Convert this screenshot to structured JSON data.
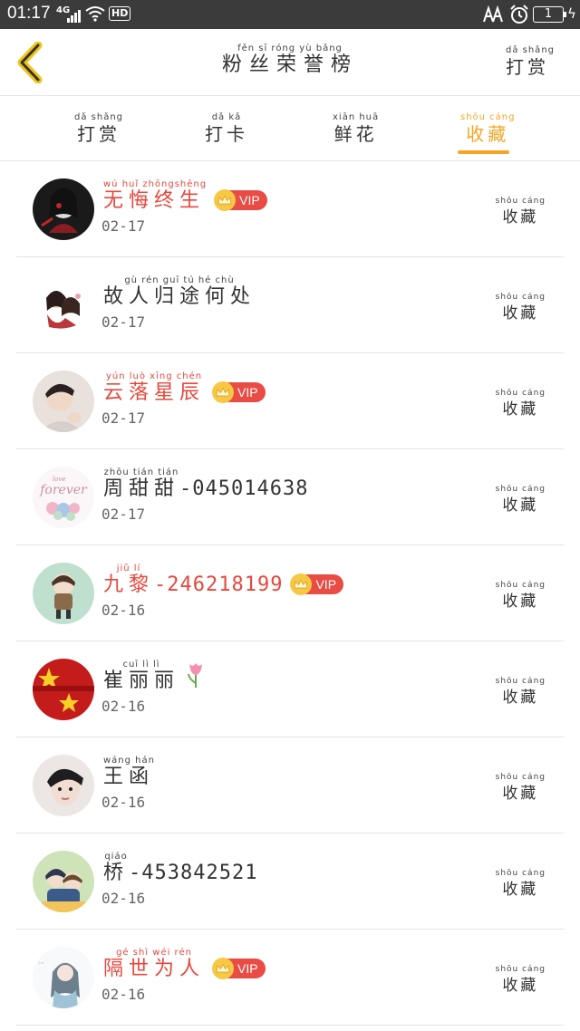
{
  "status_bar": {
    "time": "01:17",
    "network": "4G",
    "hd": "HD",
    "battery": "1",
    "bolt": "ϟ"
  },
  "header": {
    "title_pinyin": "fěn  sī  róng  yù  bǎng",
    "title": "粉丝荣誉榜",
    "reward_pinyin": "dǎ shǎng",
    "reward": "打赏"
  },
  "tabs": [
    {
      "pinyin": "dǎ shǎng",
      "label": "打赏",
      "active": false
    },
    {
      "pinyin": "dǎ  kǎ",
      "label": "打卡",
      "active": false
    },
    {
      "pinyin": "xiān huā",
      "label": "鲜花",
      "active": false
    },
    {
      "pinyin": "shōu cáng",
      "label": "收藏",
      "active": true
    }
  ],
  "vip_label": "VIP",
  "action": {
    "pinyin": "shōu cáng",
    "label": "收藏"
  },
  "rows": [
    {
      "pinyin": "wú  huǐ zhōngshēng",
      "name": "无悔终生",
      "suffix": "",
      "red": true,
      "vip": true,
      "date": "02-17",
      "avatar": "dark"
    },
    {
      "pinyin": "gù  rén  guī  tú  hé  chù",
      "name": "故人归途何处",
      "suffix": "",
      "red": false,
      "vip": false,
      "date": "02-17",
      "avatar": "couple"
    },
    {
      "pinyin": "yún luò xīng chén",
      "name": "云落星辰",
      "suffix": "",
      "red": true,
      "vip": true,
      "date": "02-17",
      "avatar": "boy"
    },
    {
      "pinyin": "zhōu tián tián",
      "name": "周甜甜",
      "suffix": "-045014638",
      "red": false,
      "vip": false,
      "date": "02-17",
      "avatar": "forever"
    },
    {
      "pinyin": "jiǔ  lí",
      "name": "九黎",
      "suffix": "-246218199",
      "red": true,
      "vip": true,
      "date": "02-16",
      "avatar": "chibi"
    },
    {
      "pinyin": "cuī  lì  lì",
      "name": "崔丽丽",
      "suffix": "",
      "red": false,
      "vip": false,
      "date": "02-16",
      "avatar": "flag",
      "tulip": true
    },
    {
      "pinyin": "wáng hán",
      "name": "王函",
      "suffix": "",
      "red": false,
      "vip": false,
      "date": "02-16",
      "avatar": "face"
    },
    {
      "pinyin": "qiáo",
      "name": "桥",
      "suffix": "-453842521",
      "red": false,
      "vip": false,
      "date": "02-16",
      "avatar": "kids"
    },
    {
      "pinyin": "gé  shì  wéi  rén",
      "name": "隔世为人",
      "suffix": "",
      "red": true,
      "vip": true,
      "date": "02-16",
      "avatar": "girl"
    }
  ],
  "avatar_text": {
    "forever_script": "forever",
    "forever_small": "love"
  },
  "colors": {
    "accent": "#f5a623",
    "vip_red": "#e94b45",
    "name_red": "#e8473c",
    "crown": "#f7c843",
    "status_bar": "#3b3b3b"
  }
}
